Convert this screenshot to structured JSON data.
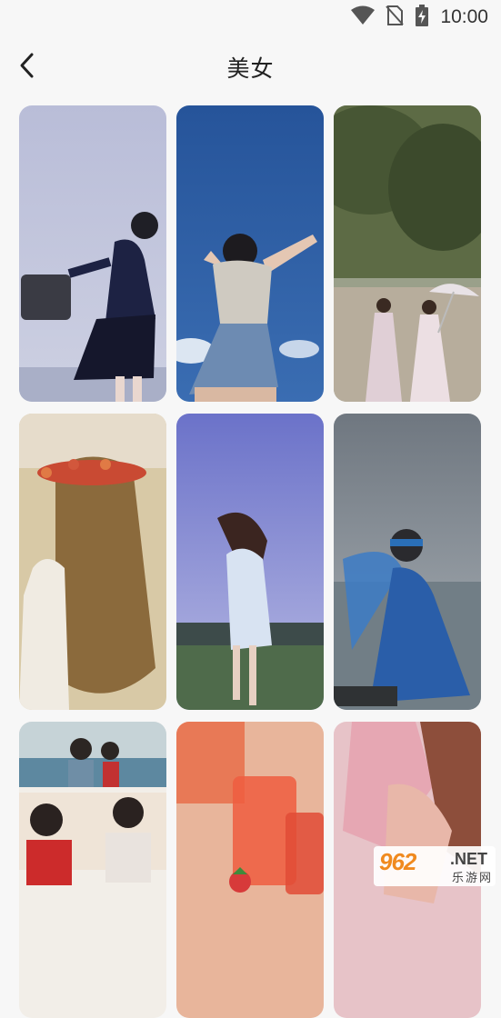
{
  "status_bar": {
    "time": "10:00",
    "icons": [
      "wifi-icon",
      "no-sim-icon",
      "battery-charging-icon"
    ]
  },
  "header": {
    "title": "美女",
    "back_icon": "chevron-left-icon"
  },
  "gallery": {
    "items": [
      {
        "name": "girl-with-bag-photo"
      },
      {
        "name": "girl-arms-up-photo"
      },
      {
        "name": "two-girls-umbrella-photo"
      },
      {
        "name": "girl-flower-crown-photo"
      },
      {
        "name": "girl-windblown-hair-photo"
      },
      {
        "name": "girl-blue-blindfold-photo"
      },
      {
        "name": "couple-scenes-photo"
      },
      {
        "name": "drinks-photo"
      },
      {
        "name": "girl-pink-dress-photo"
      }
    ]
  },
  "watermark": {
    "main": "962",
    "suffix": ".NET",
    "sub": "乐游网"
  }
}
